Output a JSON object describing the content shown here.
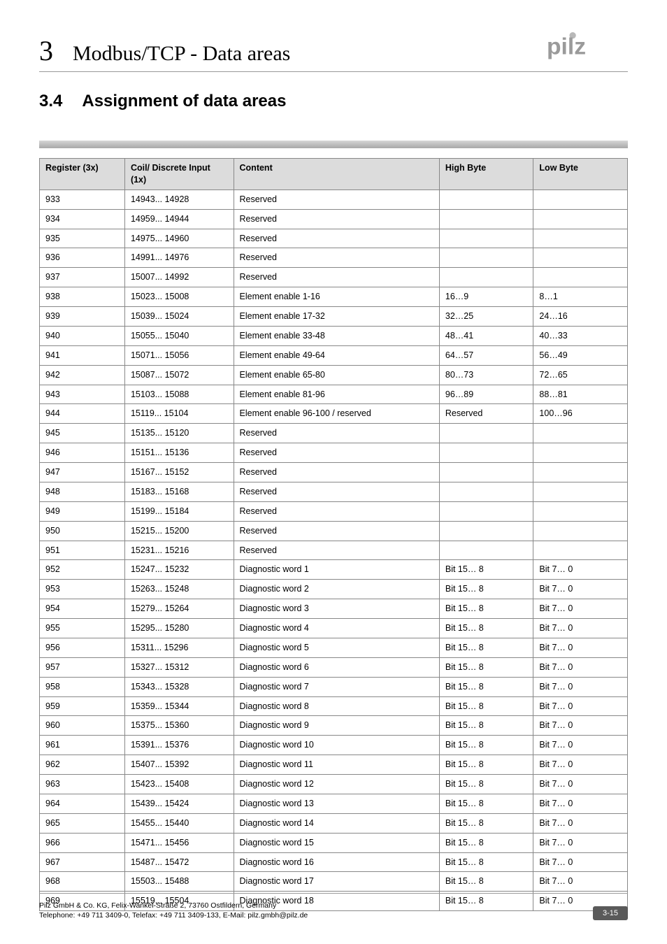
{
  "header": {
    "chapter_number": "3",
    "chapter_title": "Modbus/TCP - Data areas",
    "logo_text": "pilz"
  },
  "section": {
    "number": "3.4",
    "title": "Assignment of data areas"
  },
  "table": {
    "headers": {
      "register": "Register (3x)",
      "coil": "Coil/\nDiscrete Input (1x)",
      "content": "Content",
      "high_byte": "High Byte",
      "low_byte": "Low Byte"
    },
    "rows": [
      {
        "r": "933",
        "c": "14943... 14928",
        "ct": "Reserved",
        "h": "",
        "l": ""
      },
      {
        "r": "934",
        "c": "14959... 14944",
        "ct": "Reserved",
        "h": "",
        "l": ""
      },
      {
        "r": "935",
        "c": "14975... 14960",
        "ct": "Reserved",
        "h": "",
        "l": ""
      },
      {
        "r": "936",
        "c": "14991... 14976",
        "ct": "Reserved",
        "h": "",
        "l": ""
      },
      {
        "r": "937",
        "c": "15007... 14992",
        "ct": "Reserved",
        "h": "",
        "l": ""
      },
      {
        "r": "938",
        "c": "15023... 15008",
        "ct": "Element enable 1-16",
        "h": "16…9",
        "l": "8…1"
      },
      {
        "r": "939",
        "c": "15039... 15024",
        "ct": "Element enable 17-32",
        "h": "32…25",
        "l": "24…16"
      },
      {
        "r": "940",
        "c": "15055... 15040",
        "ct": "Element enable 33-48",
        "h": "48…41",
        "l": "40…33"
      },
      {
        "r": "941",
        "c": "15071... 15056",
        "ct": "Element enable 49-64",
        "h": "64…57",
        "l": "56…49"
      },
      {
        "r": "942",
        "c": "15087... 15072",
        "ct": "Element enable 65-80",
        "h": "80…73",
        "l": "72…65"
      },
      {
        "r": "943",
        "c": "15103... 15088",
        "ct": "Element enable 81-96",
        "h": "96…89",
        "l": "88…81"
      },
      {
        "r": "944",
        "c": "15119... 15104",
        "ct": "Element enable 96-100 / reserved",
        "h": "Reserved",
        "l": "100…96"
      },
      {
        "r": "945",
        "c": "15135... 15120",
        "ct": "Reserved",
        "h": "",
        "l": ""
      },
      {
        "r": "946",
        "c": "15151... 15136",
        "ct": "Reserved",
        "h": "",
        "l": ""
      },
      {
        "r": "947",
        "c": "15167... 15152",
        "ct": "Reserved",
        "h": "",
        "l": ""
      },
      {
        "r": "948",
        "c": "15183... 15168",
        "ct": "Reserved",
        "h": "",
        "l": ""
      },
      {
        "r": "949",
        "c": "15199... 15184",
        "ct": "Reserved",
        "h": "",
        "l": ""
      },
      {
        "r": "950",
        "c": "15215... 15200",
        "ct": "Reserved",
        "h": "",
        "l": ""
      },
      {
        "r": "951",
        "c": "15231... 15216",
        "ct": "Reserved",
        "h": "",
        "l": ""
      },
      {
        "r": "952",
        "c": "15247... 15232",
        "ct": "Diagnostic word 1",
        "h": "Bit 15… 8",
        "l": "Bit 7… 0"
      },
      {
        "r": "953",
        "c": "15263... 15248",
        "ct": "Diagnostic word 2",
        "h": "Bit 15… 8",
        "l": "Bit 7… 0"
      },
      {
        "r": "954",
        "c": "15279... 15264",
        "ct": "Diagnostic word 3",
        "h": "Bit 15… 8",
        "l": "Bit 7… 0"
      },
      {
        "r": "955",
        "c": "15295... 15280",
        "ct": "Diagnostic word 4",
        "h": "Bit 15… 8",
        "l": "Bit 7… 0"
      },
      {
        "r": "956",
        "c": "15311... 15296",
        "ct": "Diagnostic word 5",
        "h": "Bit 15… 8",
        "l": "Bit 7… 0"
      },
      {
        "r": "957",
        "c": "15327... 15312",
        "ct": "Diagnostic word 6",
        "h": "Bit 15… 8",
        "l": "Bit 7… 0"
      },
      {
        "r": "958",
        "c": "15343... 15328",
        "ct": "Diagnostic word 7",
        "h": "Bit 15… 8",
        "l": "Bit 7… 0"
      },
      {
        "r": "959",
        "c": "15359... 15344",
        "ct": "Diagnostic word 8",
        "h": "Bit 15… 8",
        "l": "Bit 7… 0"
      },
      {
        "r": "960",
        "c": "15375... 15360",
        "ct": "Diagnostic word 9",
        "h": "Bit 15… 8",
        "l": "Bit 7… 0"
      },
      {
        "r": "961",
        "c": "15391... 15376",
        "ct": "Diagnostic word 10",
        "h": "Bit 15… 8",
        "l": "Bit 7… 0"
      },
      {
        "r": "962",
        "c": "15407... 15392",
        "ct": "Diagnostic word 11",
        "h": "Bit 15… 8",
        "l": "Bit 7… 0"
      },
      {
        "r": "963",
        "c": "15423... 15408",
        "ct": "Diagnostic word 12",
        "h": "Bit 15… 8",
        "l": "Bit 7… 0"
      },
      {
        "r": "964",
        "c": "15439... 15424",
        "ct": "Diagnostic word 13",
        "h": "Bit 15… 8",
        "l": "Bit 7… 0"
      },
      {
        "r": "965",
        "c": "15455... 15440",
        "ct": "Diagnostic word 14",
        "h": "Bit 15… 8",
        "l": "Bit 7… 0"
      },
      {
        "r": "966",
        "c": "15471... 15456",
        "ct": "Diagnostic word 15",
        "h": "Bit 15… 8",
        "l": "Bit 7… 0"
      },
      {
        "r": "967",
        "c": "15487... 15472",
        "ct": "Diagnostic word 16",
        "h": "Bit 15… 8",
        "l": "Bit 7… 0"
      },
      {
        "r": "968",
        "c": "15503... 15488",
        "ct": "Diagnostic word 17",
        "h": "Bit 15… 8",
        "l": "Bit 7… 0"
      },
      {
        "r": "969",
        "c": "15519... 15504",
        "ct": "Diagnostic word 18",
        "h": "Bit 15… 8",
        "l": "Bit 7… 0"
      }
    ]
  },
  "footer": {
    "line1": "Pilz GmbH & Co. KG, Felix-Wankel-Straße 2, 73760 Ostfildern, Germany",
    "line2": "Telephone: +49 711 3409-0, Telefax: +49 711 3409-133, E-Mail: pilz.gmbh@pilz.de",
    "page": "3-15"
  }
}
